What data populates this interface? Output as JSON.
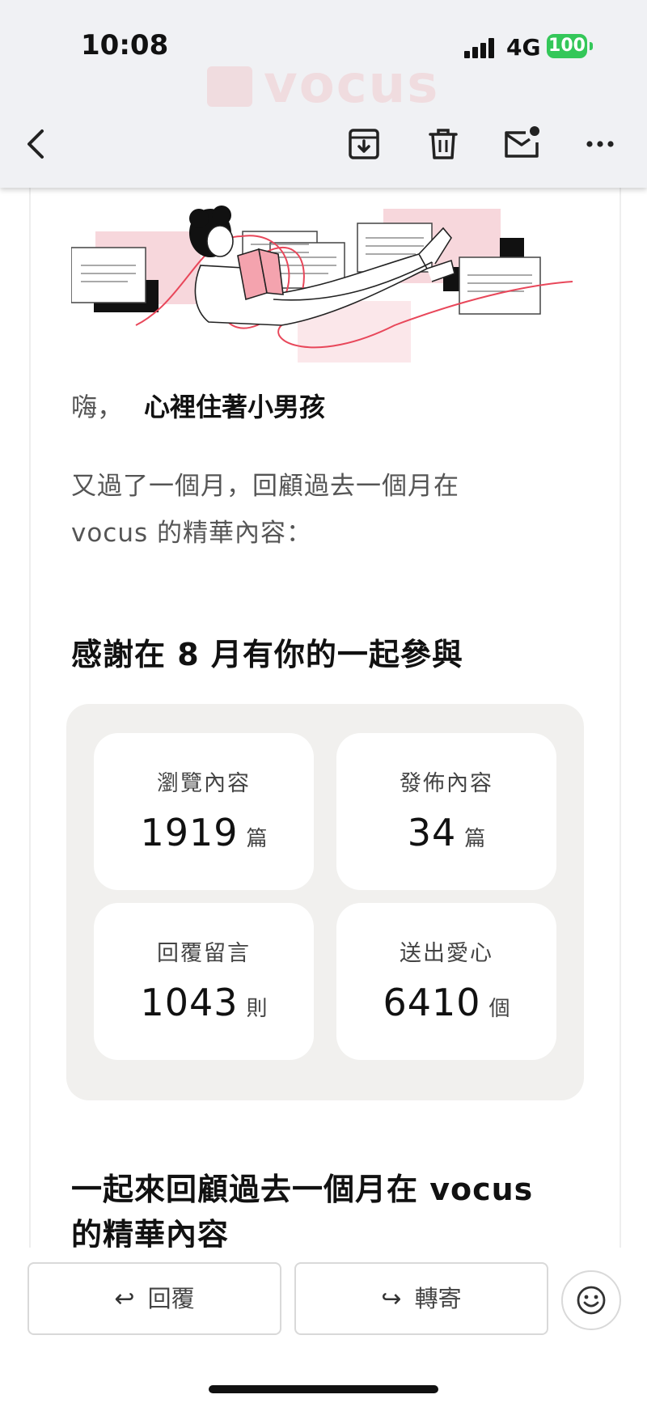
{
  "status_bar": {
    "time": "10:08",
    "network": "4G",
    "battery": "100"
  },
  "header": {
    "brand_watermark": "vocus",
    "icons": [
      "back-arrow-icon",
      "archive-icon",
      "trash-icon",
      "mark-unread-icon",
      "more-icon"
    ]
  },
  "email": {
    "greeting_hi": "嗨，",
    "user_name": "心裡住著小男孩",
    "intro_line1": "又過了一個月，回顧過去一個月在",
    "intro_line2": "vocus 的精華內容：",
    "stats_title": "感謝在 8 月有你的一起參與",
    "stats": [
      {
        "label": "瀏覽內容",
        "value": "1919",
        "unit": "篇"
      },
      {
        "label": "發佈內容",
        "value": "34",
        "unit": "篇"
      },
      {
        "label": "回覆留言",
        "value": "1043",
        "unit": "則"
      },
      {
        "label": "送出愛心",
        "value": "6410",
        "unit": "個"
      }
    ],
    "review_title_line1": "一起來回顧過去一個月在 vocus",
    "review_title_line2": "的精華內容"
  },
  "actions": {
    "reply_label": "回覆",
    "forward_label": "轉寄",
    "reply_arrow": "↩",
    "forward_arrow": "↪"
  },
  "colors": {
    "accent_pink": "#f7d7dc",
    "accent_red": "#e8475a",
    "battery_green": "#34c759"
  }
}
